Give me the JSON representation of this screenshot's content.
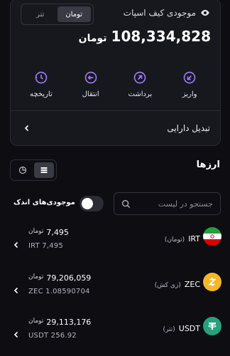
{
  "wallet": {
    "toggle": [
      "تتر",
      "تومان"
    ],
    "toggle_active": 1,
    "label": "موجودی کیف اسپات",
    "balance_value": "108,334,828",
    "balance_unit": "تومان",
    "actions": [
      {
        "id": "deposit",
        "label": "واریز",
        "icon": "arrow-down-left-icon"
      },
      {
        "id": "withdraw",
        "label": "برداشت",
        "icon": "arrow-up-right-icon"
      },
      {
        "id": "transfer",
        "label": "انتقال",
        "icon": "arrow-left-circle-icon"
      },
      {
        "id": "history",
        "label": "تاریخچه",
        "icon": "clock-icon"
      }
    ],
    "convert_label": "تبدیل دارایی"
  },
  "currencies": {
    "title": "ارزها",
    "search_placeholder": "جستجو در لیست",
    "small_balances_label": "موجودی‌های اندک",
    "small_balances_on": false,
    "assets": [
      {
        "symbol": "IRT",
        "fa_name": "(تومان)",
        "toman_value": "7,495",
        "toman_unit": "تومان",
        "qty": "IRT 7,495",
        "logo": "iran-flag-icon",
        "logo_color": "#ffffff"
      },
      {
        "symbol": "ZEC",
        "fa_name": "(زی کش)",
        "toman_value": "79,206,059",
        "toman_unit": "تومان",
        "qty": "ZEC 1.08590704",
        "logo": "zcash-icon",
        "logo_color": "#f4b728"
      },
      {
        "symbol": "USDT",
        "fa_name": "(تتر)",
        "toman_value": "29,113,176",
        "toman_unit": "تومان",
        "qty": "USDT 256.92",
        "logo": "tether-icon",
        "logo_color": "#26a17b"
      }
    ]
  },
  "colors": {
    "accent": "#9b7bf2",
    "background": "#0d0d12",
    "card": "#17171e"
  }
}
